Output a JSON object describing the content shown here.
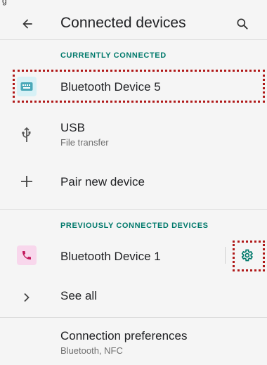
{
  "status_bar": {
    "text": "g"
  },
  "app_bar": {
    "title": "Connected devices"
  },
  "currently_connected": {
    "header": "CURRENTLY CONNECTED",
    "device": {
      "name": "Bluetooth Device 5",
      "icon": "keyboard-icon"
    },
    "usb": {
      "title": "USB",
      "subtitle": "File transfer",
      "icon": "usb-icon"
    },
    "pair": {
      "title": "Pair new device",
      "icon": "plus-icon"
    }
  },
  "previously_connected": {
    "header": "PREVIOUSLY CONNECTED DEVICES",
    "device": {
      "name": "Bluetooth Device 1",
      "icon": "phone-icon",
      "settings_icon": "gear-icon"
    },
    "see_all": {
      "title": "See all",
      "icon": "chevron-right-icon"
    }
  },
  "connection_preferences": {
    "title": "Connection preferences",
    "subtitle": "Bluetooth, NFC"
  },
  "colors": {
    "accent": "#00796b",
    "highlight": "#b01919",
    "keyboard_bg": "#d7f1f6",
    "phone_bg": "#f8d7ec",
    "phone_fg": "#c2185b",
    "keyboard_fg": "#4aa8b8"
  }
}
